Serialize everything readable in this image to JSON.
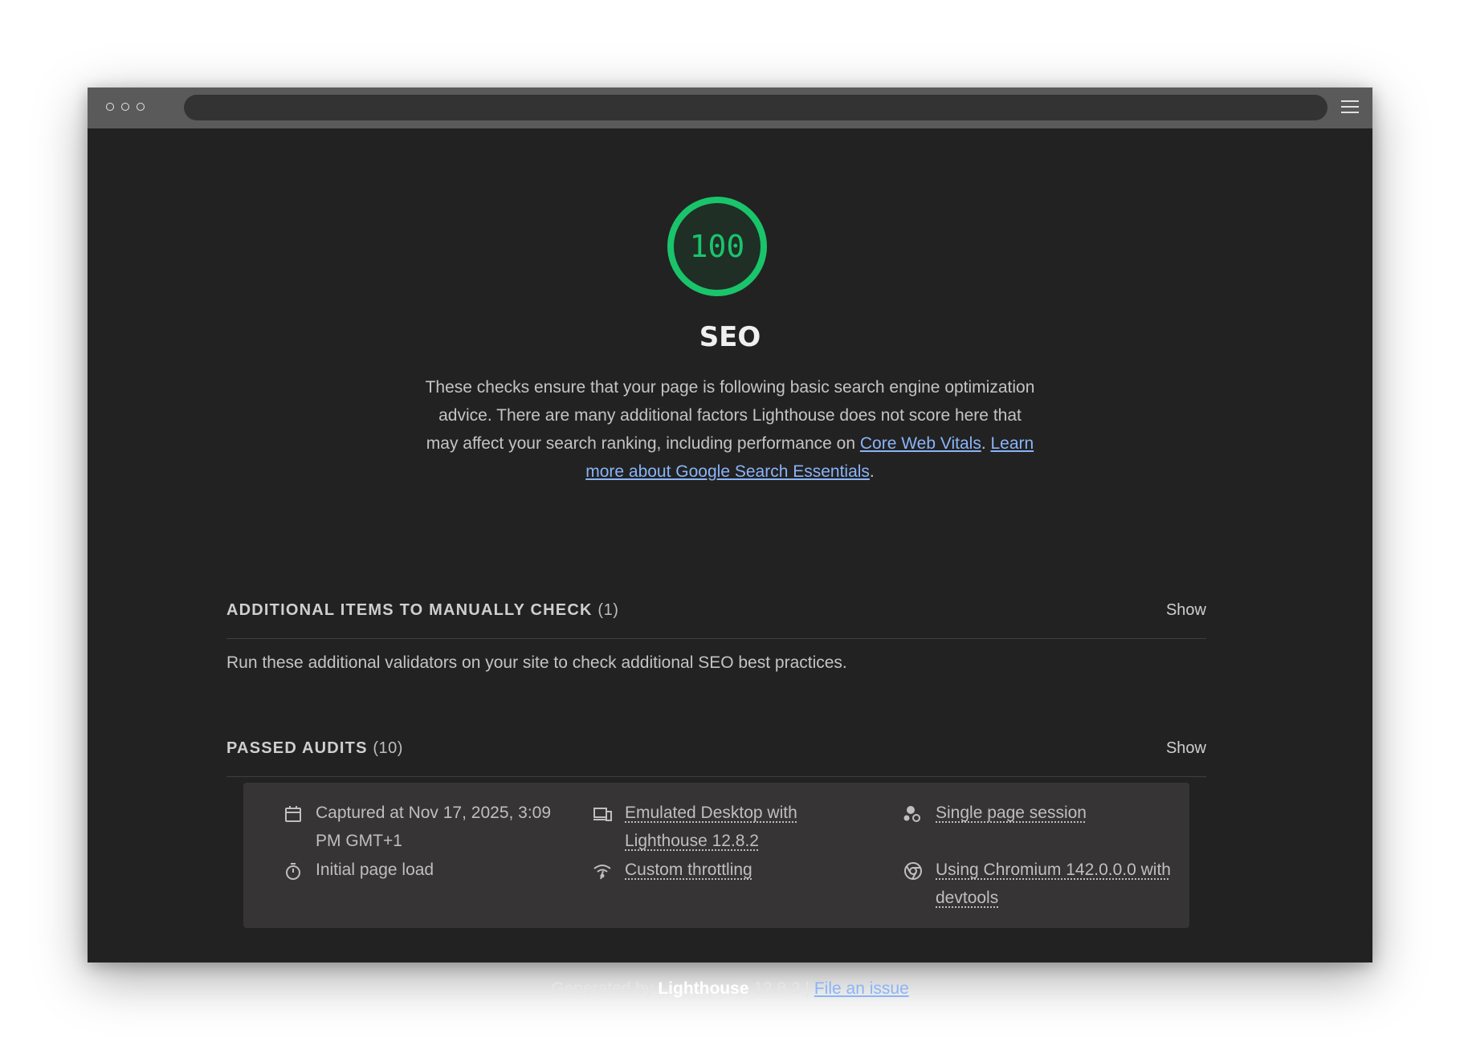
{
  "score": {
    "value": "100",
    "color": "#1ac46b"
  },
  "category": {
    "title": "SEO",
    "description_text": "These checks ensure that your page is following basic search engine optimization advice. There are many additional factors Lighthouse does not score here that may affect your search ranking, including performance on ",
    "link_core_web_vitals": "Core Web Vitals",
    "separator": ". ",
    "link_search_essentials": "Learn more about Google Search Essentials",
    "end_period": "."
  },
  "sections": [
    {
      "title": "ADDITIONAL ITEMS TO MANUALLY CHECK",
      "count": "(1)",
      "toggle": "Show",
      "description": "Run these additional validators on your site to check additional SEO best practices."
    },
    {
      "title": "PASSED AUDITS",
      "count": "(10)",
      "toggle": "Show"
    }
  ],
  "environment": {
    "captured": "Captured at Nov 17, 2025, 3:09 PM GMT+1",
    "emulated": "Emulated Desktop with Lighthouse 12.8.2",
    "session": "Single page session",
    "load": "Initial page load",
    "throttling": "Custom throttling",
    "chromium": "Using Chromium 142.0.0.0 with devtools"
  },
  "footer": {
    "generated_by": "Generated by ",
    "brand": "Lighthouse",
    "version": " 12.8.2 | ",
    "file_issue": "File an issue"
  },
  "icons": {
    "captured": "calendar-icon",
    "emulated": "devices-icon",
    "session": "person-icon",
    "load": "timer-icon",
    "throttling": "wifi-icon",
    "chromium": "chromium-icon"
  }
}
